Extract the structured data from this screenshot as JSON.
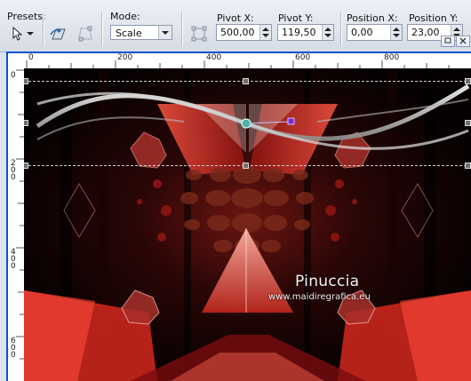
{
  "toolbar": {
    "presets_label": "Presets:",
    "mode_label": "Mode:",
    "mode_value": "Scale",
    "pivot_x_label": "Pivot X:",
    "pivot_x_value": "500,00",
    "pivot_y_label": "Pivot Y:",
    "pivot_y_value": "119,50",
    "position_x_label": "Position X:",
    "position_x_value": "0,00",
    "position_y_label": "Position Y:",
    "position_y_value": "23,00"
  },
  "rulers": {
    "top_ticks": [
      "0",
      "200",
      "400",
      "600",
      "800"
    ],
    "left_ticks": [
      "0",
      "2\n0\n0",
      "4\n0\n0",
      "6\n0\n0"
    ]
  },
  "canvas": {
    "watermark_name": "Pinuccia",
    "watermark_url": "www.maidiregrafica.eu"
  },
  "colors": {
    "accent_red": "#e23a2e",
    "deep_red": "#7a0c10",
    "window_blue": "#0a52d6"
  }
}
